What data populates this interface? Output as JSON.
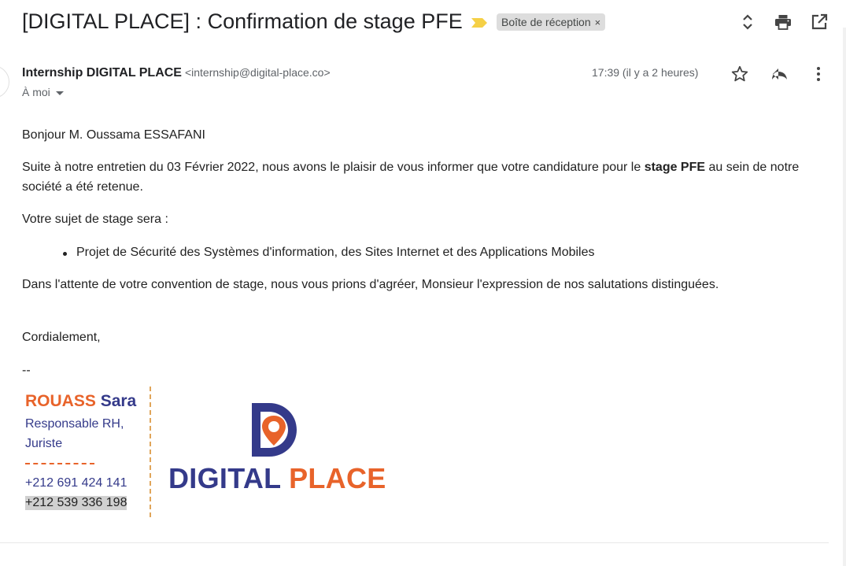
{
  "header": {
    "subject": "[DIGITAL PLACE] : Confirmation de stage PFE",
    "label": "Boîte de réception",
    "label_remove": "×"
  },
  "message": {
    "sender_name": "Internship DIGITAL PLACE",
    "sender_email": "<internship@digital-place.co>",
    "recipient": "À moi",
    "timestamp": "17:39 (il y a 2 heures)",
    "greeting": "Bonjour M. Oussama ESSAFANI",
    "para1_before": "Suite à notre entretien du 03 Février 2022, nous avons le plaisir de vous informer que votre candidature pour le ",
    "para1_bold": "stage PFE",
    "para1_after": " au sein de notre société a été retenue.",
    "subject_intro": "Votre sujet de stage sera :",
    "subject_item": "Projet de Sécurité des Systèmes d'information, des Sites Internet et des Applications Mobiles",
    "para2": "Dans l'attente de votre convention de stage, nous vous prions d'agréer, Monsieur l'expression de nos salutations distinguées.",
    "closing": "Cordialement,",
    "sig_sep": "--"
  },
  "signature": {
    "last_name": "ROUASS",
    "first_name": "Sara",
    "title_line1": "Responsable RH,",
    "title_line2": "Juriste",
    "phone1": "+212 691 424 141",
    "phone2": "+212 539 336 198",
    "logo_word1": "DIGITAL",
    "logo_word2": "PLACE"
  },
  "icons": {
    "header": [
      "importance-marker-icon",
      "expand-collapse-icon",
      "print-icon",
      "open-new-window-icon"
    ],
    "message": [
      "star-icon",
      "reply-icon",
      "more-vert-icon"
    ]
  },
  "colors": {
    "brand_orange": "#e8632a",
    "brand_navy": "#343a8a",
    "importance_yellow": "#f5d046",
    "label_chip_bg": "#dddddd"
  }
}
